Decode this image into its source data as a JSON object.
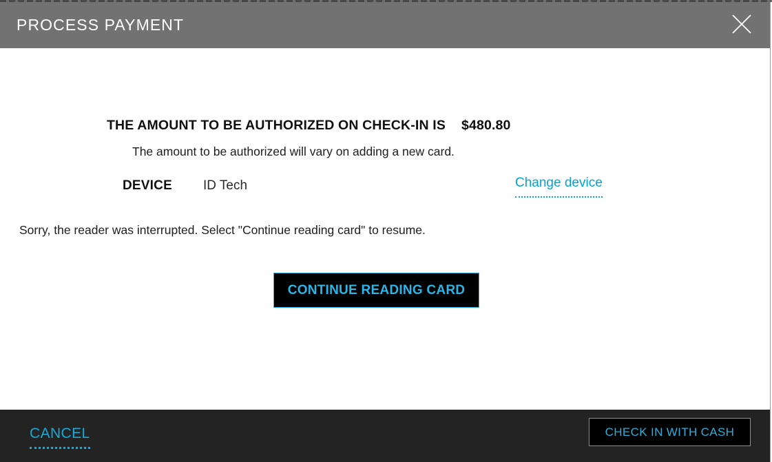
{
  "colors": {
    "accent_cyan": "#00a5d4",
    "button_cyan": "#29b6e8",
    "header_gray": "#727272",
    "footer_dark": "#232323",
    "button_black": "#000000"
  },
  "header": {
    "title": "PROCESS PAYMENT",
    "close_icon": "close-x-icon"
  },
  "body": {
    "amount_label": "THE AMOUNT TO BE AUTHORIZED ON CHECK-IN IS",
    "amount_value": "$480.80",
    "amount_note": "The amount to be authorized will vary on adding a new card.",
    "device_label": "DEVICE",
    "device_value": "ID Tech",
    "change_device_link": "Change device",
    "error_message": "Sorry, the reader was interrupted. Select \"Continue reading card\" to resume.",
    "continue_button": "CONTINUE READING CARD"
  },
  "footer": {
    "cancel_link": "CANCEL",
    "cash_button": "CHECK IN WITH CASH"
  }
}
